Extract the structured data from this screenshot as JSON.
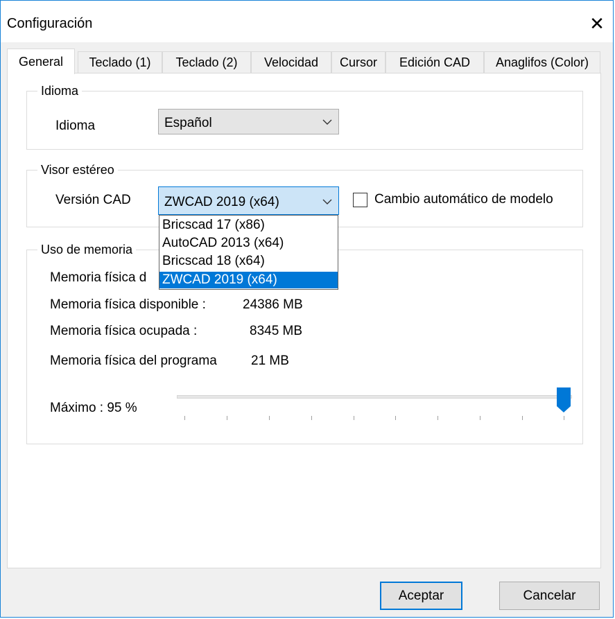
{
  "window": {
    "title": "Configuración"
  },
  "tabs": [
    "General",
    "Teclado (1)",
    "Teclado (2)",
    "Velocidad",
    "Cursor",
    "Edición CAD",
    "Anaglifos (Color)"
  ],
  "idioma_group": {
    "title": "Idioma",
    "label": "Idioma",
    "value": "Español"
  },
  "visor_group": {
    "title": "Visor estéreo",
    "label": "Versión CAD",
    "value": "ZWCAD 2019 (x64)",
    "checkbox_label": "Cambio automático de modelo",
    "checkbox_checked": false,
    "options": [
      "Bricscad 17 (x86)",
      "AutoCAD 2013 (x64)",
      "Bricscad 18 (x64)",
      "ZWCAD 2019 (x64)"
    ],
    "selected_index": 3
  },
  "memoria_group": {
    "title": "Uso de memoria",
    "rows": [
      {
        "label": "Memoria física disponible :",
        "value": "24386 MB"
      },
      {
        "label": "Memoria física ocupada :",
        "value": "8345 MB"
      },
      {
        "label": "Memoria física del programa",
        "value": "21 MB"
      }
    ],
    "partial_label": "Memoria física d",
    "max_label": "Máximo : 95 %",
    "max_percent": 95
  },
  "buttons": {
    "accept": "Aceptar",
    "cancel": "Cancelar"
  },
  "colors": {
    "accent": "#0078d7",
    "window_border": "#1883d7"
  }
}
